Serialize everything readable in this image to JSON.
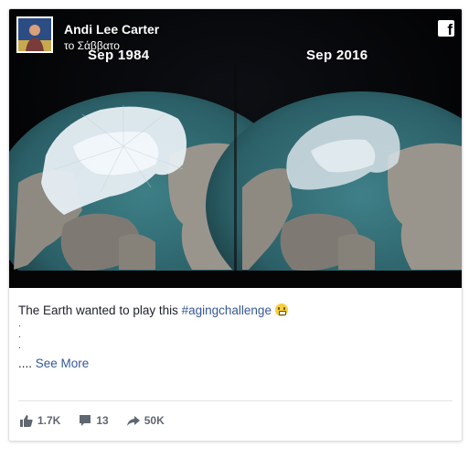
{
  "post": {
    "author": "Andi Lee Carter",
    "timestamp": "το Σάββατο",
    "media": {
      "left_label": "Sep 1984",
      "right_label": "Sep 2016",
      "platform_icon": "facebook-f-icon"
    },
    "text": {
      "intro": "The Earth wanted to play this ",
      "hashtag": "#agingchallenge",
      "emoji": "grimacing-face-emoji",
      "dots": [
        ".",
        ".",
        "."
      ],
      "ellipsis": "....",
      "see_more": "See More"
    },
    "stats": {
      "likes": "1.7K",
      "comments": "13",
      "shares": "50K"
    }
  },
  "colors": {
    "link": "#365899",
    "text": "#1d2129",
    "muted": "#606770",
    "ocean": "#2f6a72",
    "ice": "#e6eef3"
  }
}
